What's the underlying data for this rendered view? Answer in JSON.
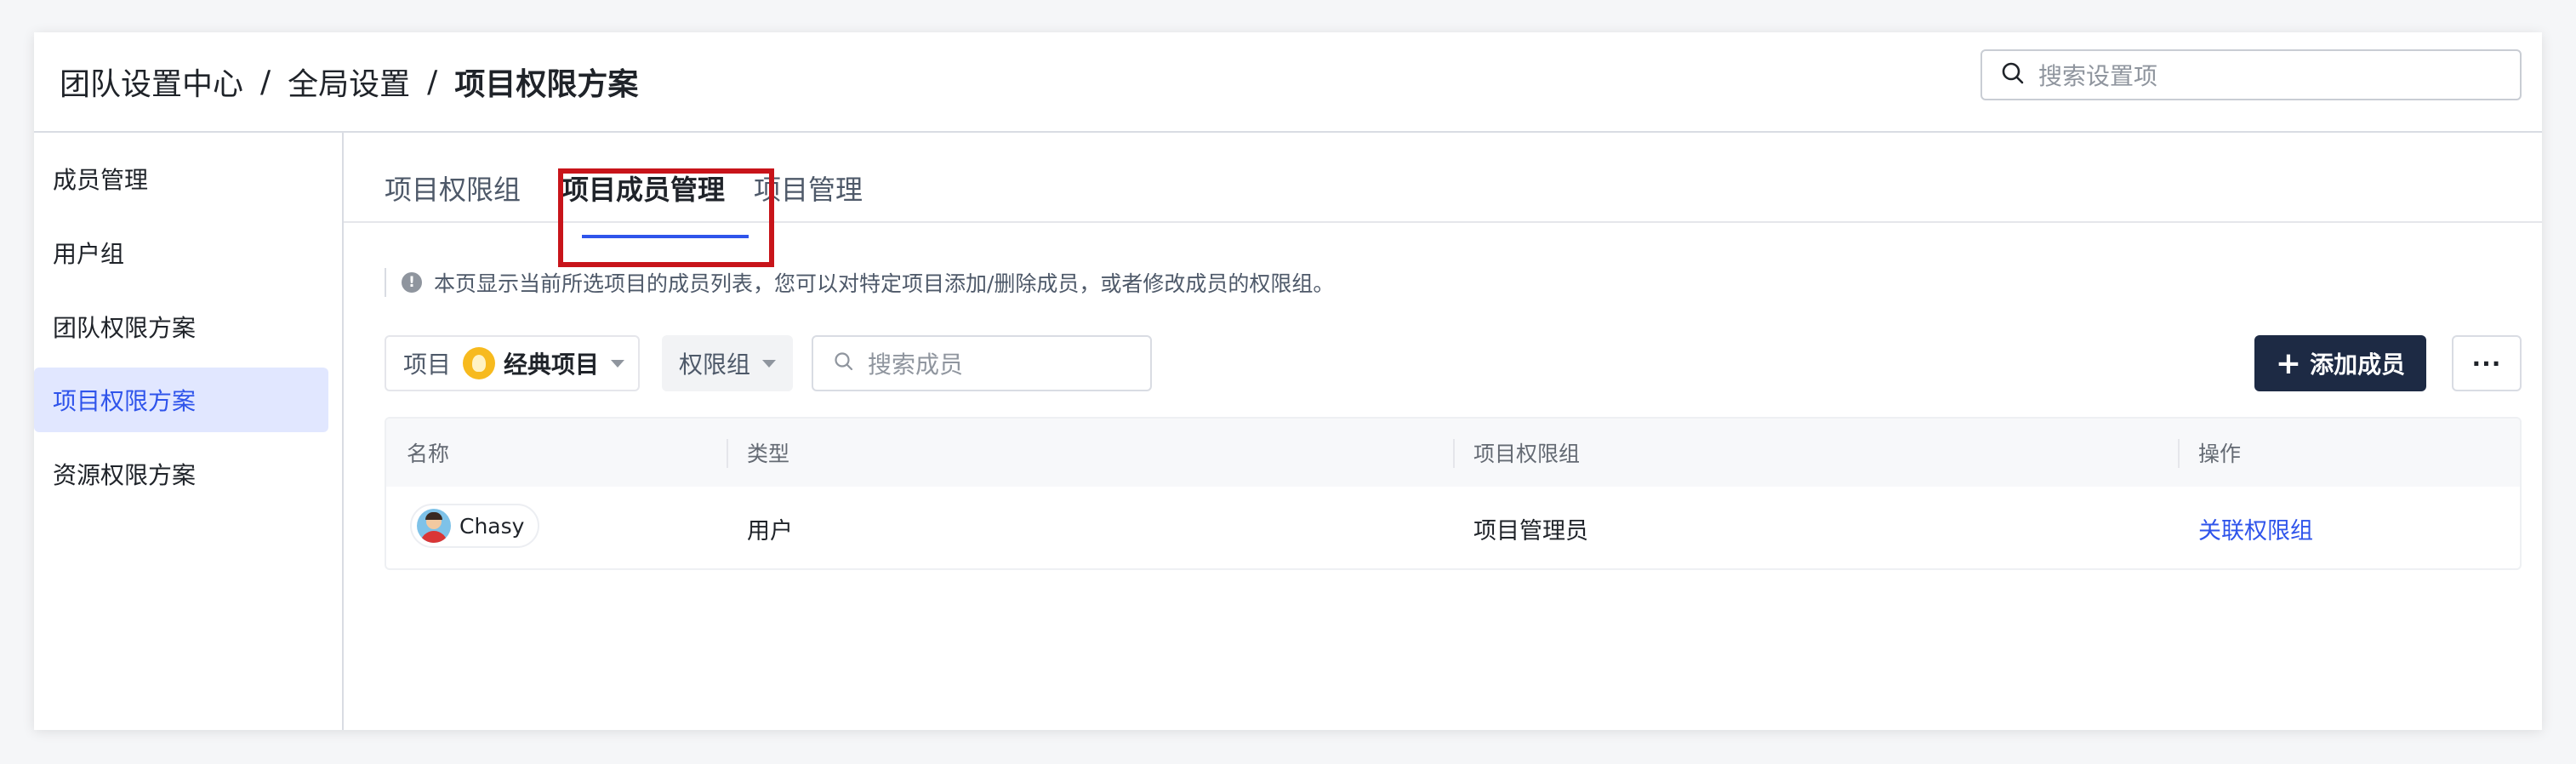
{
  "breadcrumb": {
    "level1": "团队设置中心",
    "level2": "全局设置",
    "current": "项目权限方案",
    "separator": "/"
  },
  "top_search": {
    "placeholder": "搜索设置项",
    "icon": "search-icon"
  },
  "sidebar": {
    "items": [
      {
        "label": "成员管理",
        "active": false
      },
      {
        "label": "用户组",
        "active": false
      },
      {
        "label": "团队权限方案",
        "active": false
      },
      {
        "label": "项目权限方案",
        "active": true
      },
      {
        "label": "资源权限方案",
        "active": false
      }
    ]
  },
  "tabs": [
    {
      "label": "项目权限组",
      "active": false
    },
    {
      "label": "项目成员管理",
      "active": true
    },
    {
      "label": "项目管理",
      "active": false
    }
  ],
  "notice": {
    "text": "本页显示当前所选项目的成员列表，您可以对特定项目添加/删除成员，或者修改成员的权限组。",
    "icon": "info-icon"
  },
  "filters": {
    "project": {
      "label": "项目",
      "value": "经典项目",
      "icon": "bulb-icon"
    },
    "group": {
      "label": "权限组"
    },
    "member_search": {
      "placeholder": "搜索成员",
      "icon": "search-icon"
    }
  },
  "actions": {
    "add_label": "添加成员",
    "add_icon": "plus-icon",
    "more_label": "···"
  },
  "table": {
    "headers": [
      "名称",
      "类型",
      "项目权限组",
      "操作"
    ],
    "rows": [
      {
        "name": "Chasy",
        "type": "用户",
        "group": "项目管理员",
        "action": "关联权限组"
      }
    ]
  },
  "colors": {
    "accent": "#2f54eb",
    "primary_button": "#1d2a44",
    "highlight": "#c8141a",
    "active_bg": "#e1e7ff"
  }
}
